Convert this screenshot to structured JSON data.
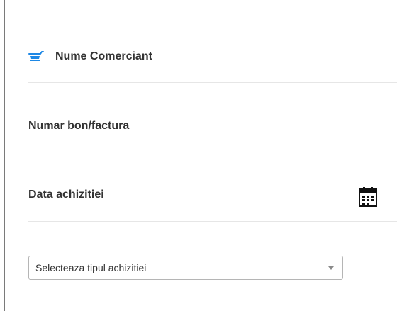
{
  "form": {
    "merchant_label": "Nume Comerciant",
    "receipt_label": "Numar bon/factura",
    "date_label": "Data achizitiei",
    "purchase_type_select": {
      "selected": "Selecteaza tipul achizitiei"
    }
  },
  "icons": {
    "merchant": "cart-icon",
    "date": "calendar-icon",
    "select": "chevron-down-icon"
  },
  "colors": {
    "accent": "#1e88e5",
    "label_text": "#333333",
    "divider": "#e6e6e6"
  }
}
